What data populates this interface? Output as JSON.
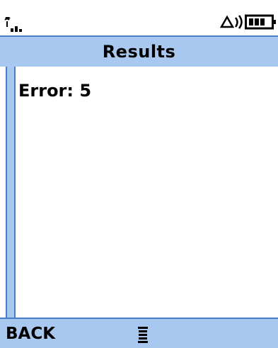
{
  "title_bar": {
    "title": "Results"
  },
  "content": {
    "result_text": "Error: 5"
  },
  "softkeys": {
    "left_label": "BACK",
    "center_icon": "menu-icon"
  },
  "status_bar": {
    "icons": [
      "signal-icon",
      "ringer-icon",
      "battery-icon"
    ]
  },
  "colors": {
    "accent": "#a8c8f0",
    "accent_border": "#4a7fc8",
    "background": "#ffffff",
    "text": "#000000"
  }
}
